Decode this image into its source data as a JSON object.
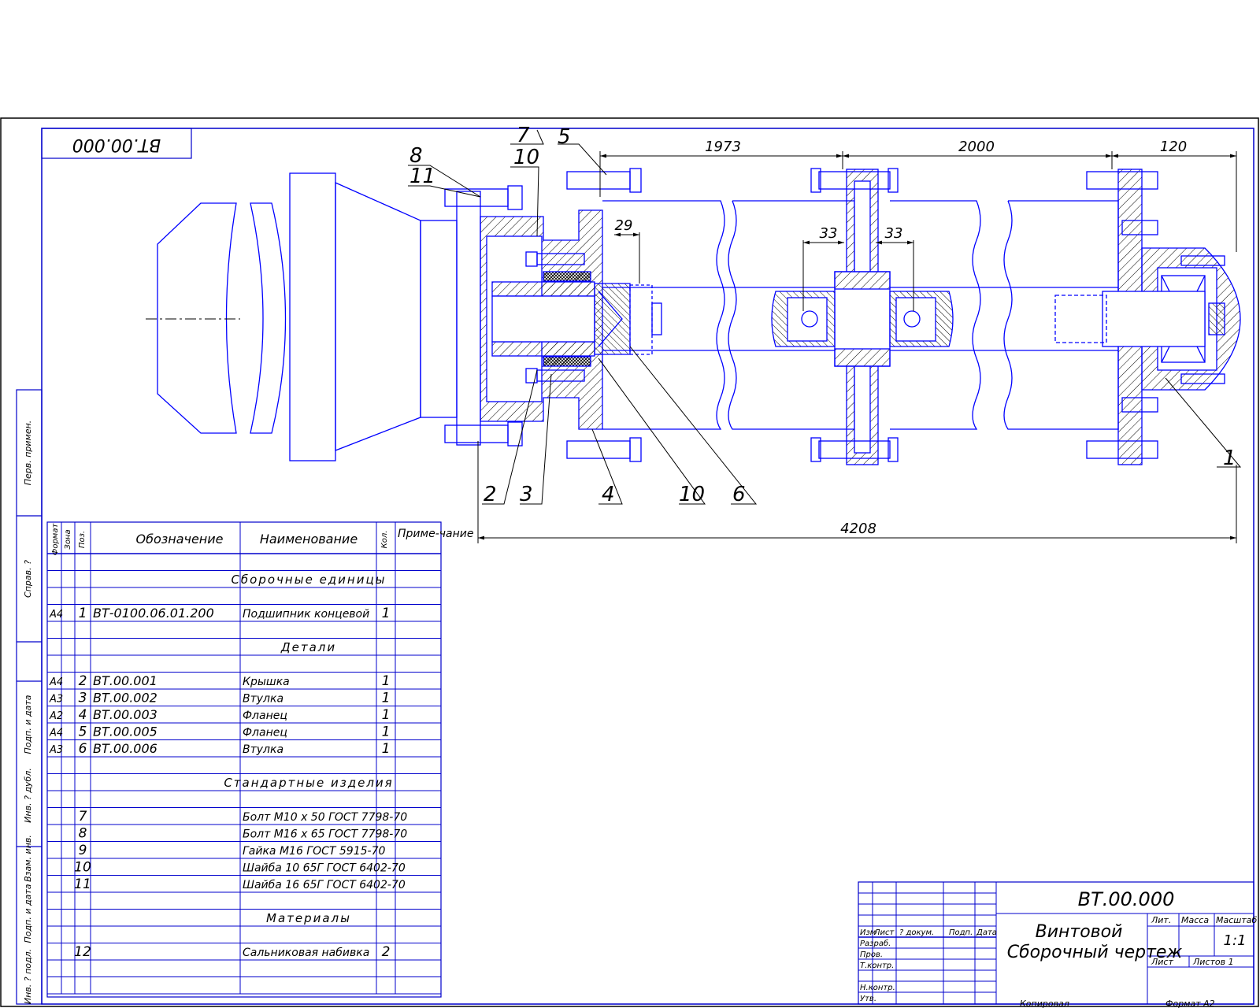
{
  "stamp_code": "ВТ.00.000",
  "title_block": {
    "code": "ВТ.00.000",
    "name_line1": "Винтовой",
    "name_line2": "Сборочный чертеж",
    "lit_label": "Лит.",
    "mass_label": "Масса",
    "scale_label": "Масштаб",
    "scale_value": "1:1",
    "sheet_label": "Лист",
    "sheets_label": "Листов 1",
    "copied_label": "Копировал",
    "format_label": "Формат А2",
    "header_cells": [
      "Изм",
      "Лист",
      "? докум.",
      "Подп.",
      "Дата"
    ],
    "roles": [
      "Разраб.",
      "Пров.",
      "Т.контр.",
      "",
      "Н.контр.",
      "Утв."
    ]
  },
  "left_strip": [
    "Перв. примен.",
    "Справ. ?",
    "Инв. ? подл.",
    "Подп. и дата",
    "Взам. инв.",
    "Инв. ? дубл.",
    "Подп. и дата"
  ],
  "spec": {
    "headers": {
      "format": "Формат",
      "zone": "Зона",
      "pos": "Поз.",
      "designation": "Обозначение",
      "name": "Наименование",
      "qty": "Кол.",
      "note": "Приме-чание"
    },
    "rows": [
      {
        "format": "",
        "pos": "",
        "designation": "",
        "name": "",
        "qty": ""
      },
      {
        "format": "",
        "pos": "",
        "designation": "",
        "name": "Сборочные единицы",
        "qty": "",
        "section": true
      },
      {
        "format": "",
        "pos": "",
        "designation": "",
        "name": "",
        "qty": ""
      },
      {
        "format": "А4",
        "pos": "1",
        "designation": "ВТ-0100.06.01.200",
        "name": "Подшипник концевой",
        "qty": "1"
      },
      {
        "format": "",
        "pos": "",
        "designation": "",
        "name": "",
        "qty": ""
      },
      {
        "format": "",
        "pos": "",
        "designation": "",
        "name": "Детали",
        "qty": "",
        "section": true
      },
      {
        "format": "",
        "pos": "",
        "designation": "",
        "name": "",
        "qty": ""
      },
      {
        "format": "А4",
        "pos": "2",
        "designation": "ВТ.00.001",
        "name": "Крышка",
        "qty": "1"
      },
      {
        "format": "А3",
        "pos": "3",
        "designation": "ВТ.00.002",
        "name": "Втулка",
        "qty": "1"
      },
      {
        "format": "А2",
        "pos": "4",
        "designation": "ВТ.00.003",
        "name": "Фланец",
        "qty": "1"
      },
      {
        "format": "А4",
        "pos": "5",
        "designation": "ВТ.00.005",
        "name": "Фланец",
        "qty": "1"
      },
      {
        "format": "А3",
        "pos": "6",
        "designation": "ВТ.00.006",
        "name": "Втулка",
        "qty": "1"
      },
      {
        "format": "",
        "pos": "",
        "designation": "",
        "name": "",
        "qty": ""
      },
      {
        "format": "",
        "pos": "",
        "designation": "",
        "name": "Стандартные изделия",
        "qty": "",
        "section": true
      },
      {
        "format": "",
        "pos": "",
        "designation": "",
        "name": "",
        "qty": ""
      },
      {
        "format": "",
        "pos": "7",
        "designation": "",
        "name": "Болт М10 х 50 ГОСТ 7798-70",
        "qty": ""
      },
      {
        "format": "",
        "pos": "8",
        "designation": "",
        "name": "Болт М16 х 65 ГОСТ 7798-70",
        "qty": ""
      },
      {
        "format": "",
        "pos": "9",
        "designation": "",
        "name": "Гайка М16 ГОСТ 5915-70",
        "qty": ""
      },
      {
        "format": "",
        "pos": "10",
        "designation": "",
        "name": "Шайба 10 65Г ГОСТ 6402-70",
        "qty": ""
      },
      {
        "format": "",
        "pos": "11",
        "designation": "",
        "name": "Шайба 16 65Г ГОСТ 6402-70",
        "qty": ""
      },
      {
        "format": "",
        "pos": "",
        "designation": "",
        "name": "",
        "qty": ""
      },
      {
        "format": "",
        "pos": "",
        "designation": "",
        "name": "Материалы",
        "qty": "",
        "section": true
      },
      {
        "format": "",
        "pos": "",
        "designation": "",
        "name": "",
        "qty": ""
      },
      {
        "format": "",
        "pos": "12",
        "designation": "",
        "name": "Сальниковая набивка",
        "qty": "2"
      },
      {
        "format": "",
        "pos": "",
        "designation": "",
        "name": "",
        "qty": ""
      },
      {
        "format": "",
        "pos": "",
        "designation": "",
        "name": "",
        "qty": ""
      }
    ]
  },
  "dimensions": {
    "d1973": "1973",
    "d2000": "2000",
    "d120": "120",
    "d29": "29",
    "d33a": "33",
    "d33b": "33",
    "d4208": "4208"
  },
  "leaders": {
    "p7": "7",
    "p10top": "10",
    "p8": "8",
    "p11": "11",
    "p5": "5",
    "p2": "2",
    "p3": "3",
    "p4": "4",
    "p10bot": "10",
    "p6": "6",
    "p1": "1"
  },
  "colors": {
    "frame": "#0000cc",
    "drawing": "#0000ff",
    "text": "#000000",
    "hatch": "#000000"
  }
}
